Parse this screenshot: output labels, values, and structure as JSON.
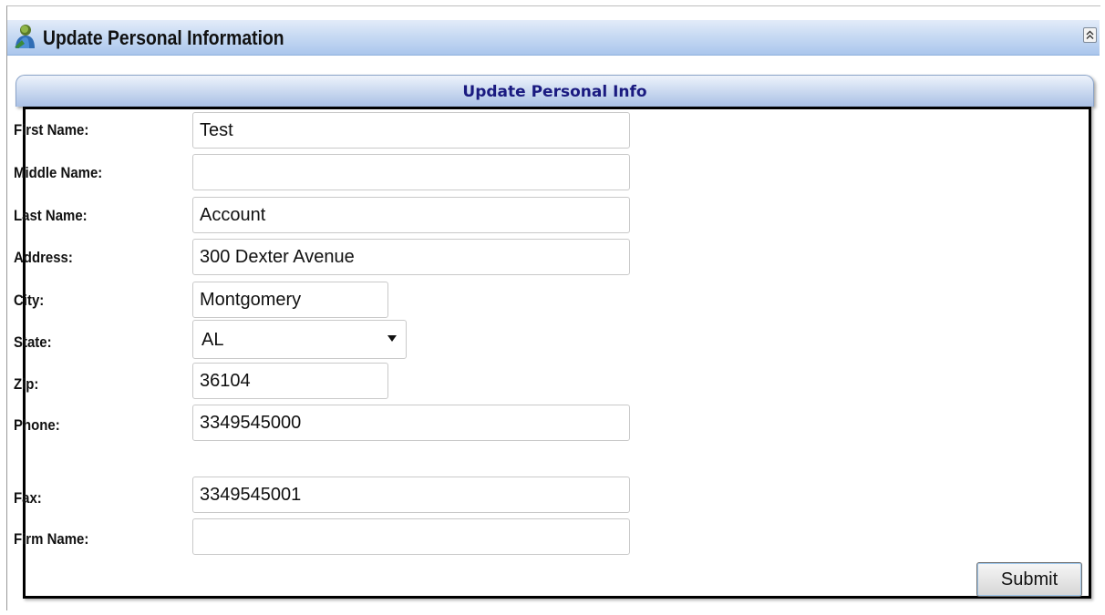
{
  "window": {
    "title": "Update Personal Information",
    "icons": {
      "app": "user-icon",
      "collapse": "double-chevron-up-icon"
    }
  },
  "panel": {
    "title": "Update Personal Info"
  },
  "form": {
    "first_name": {
      "label": "First Name:",
      "value": "Test"
    },
    "middle_name": {
      "label": "Middle Name:",
      "value": ""
    },
    "last_name": {
      "label": "Last Name:",
      "value": "Account"
    },
    "address": {
      "label": "Address:",
      "value": "300 Dexter Avenue"
    },
    "city": {
      "label": "City:",
      "value": "Montgomery"
    },
    "state": {
      "label": "State:",
      "value": "AL"
    },
    "zip": {
      "label": "Zip:",
      "value": "36104"
    },
    "phone": {
      "label": "Phone:",
      "value": "3349545000"
    },
    "fax": {
      "label": "Fax:",
      "value": "3349545001"
    },
    "firm_name": {
      "label": "Firm Name:",
      "value": ""
    },
    "submit_label": "Submit"
  },
  "colors": {
    "header_gradient_top": "#e3ecf9",
    "header_gradient_bottom": "#aac6ec",
    "panel_title": "#1a1a80",
    "panel_border": "#000000"
  }
}
